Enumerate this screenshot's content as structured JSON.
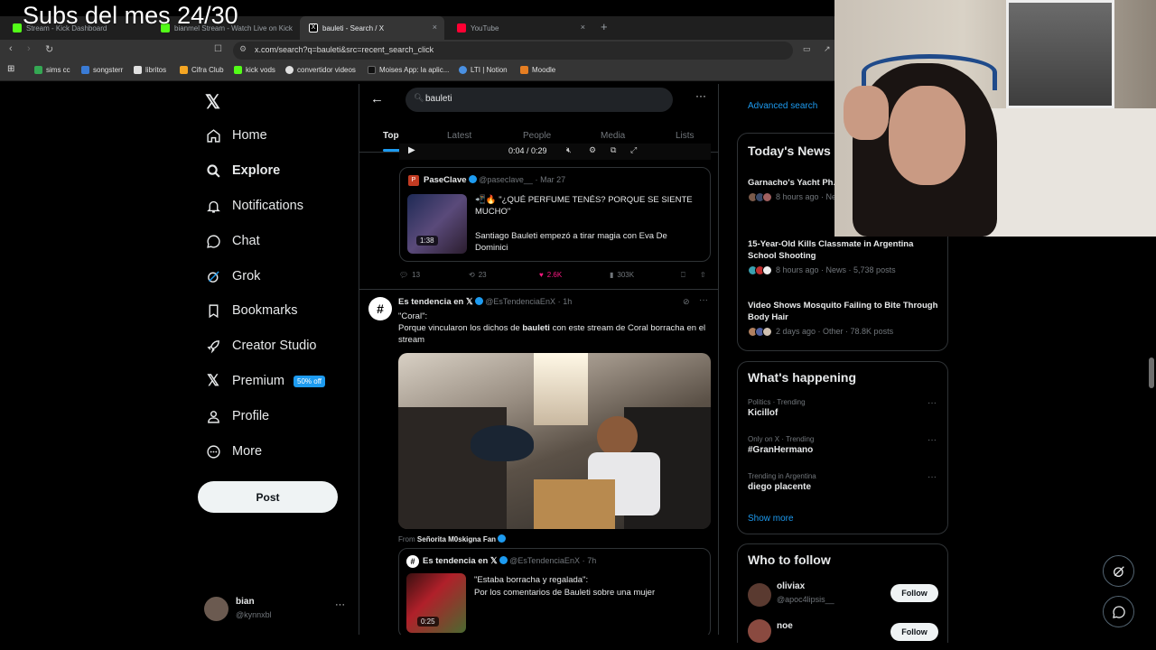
{
  "overlay": {
    "title": "Subs del mes 24/30"
  },
  "browser": {
    "tabs": [
      {
        "label": "Stream - Kick Dashboard",
        "color": "#53fc18"
      },
      {
        "label": "bianmel Stream - Watch Live on Kick",
        "color": "#53fc18"
      },
      {
        "label": "bauleti - Search / X",
        "color": "#ffffff"
      },
      {
        "label": "YouTube",
        "color": "#ff0033"
      }
    ],
    "new_tab": "+",
    "close": "×",
    "url": "x.com/search?q=bauleti&src=recent_search_click",
    "bookmarks": [
      {
        "label": "sims cc",
        "color": "#34a853"
      },
      {
        "label": "songsterr",
        "color": "#3a7bd5"
      },
      {
        "label": "libritos",
        "color": "#e0e0e0"
      },
      {
        "label": "Cifra Club",
        "color": "#f5a623"
      },
      {
        "label": "kick vods",
        "color": "#53fc18"
      },
      {
        "label": "convertidor videos",
        "color": "#e0e0e0"
      },
      {
        "label": "Moises App: la aplic...",
        "color": "#111111"
      },
      {
        "label": "LTI | Notion",
        "color": "#4a90e2"
      },
      {
        "label": "Moodle",
        "color": "#e67e22"
      }
    ]
  },
  "nav": {
    "items": [
      {
        "label": "Home",
        "icon": "home-icon"
      },
      {
        "label": "Explore",
        "icon": "search-icon"
      },
      {
        "label": "Notifications",
        "icon": "bell-icon"
      },
      {
        "label": "Chat",
        "icon": "chat-icon"
      },
      {
        "label": "Grok",
        "icon": "grok-icon"
      },
      {
        "label": "Bookmarks",
        "icon": "bookmark-icon"
      },
      {
        "label": "Creator Studio",
        "icon": "rocket-icon"
      },
      {
        "label": "Premium",
        "icon": "x-logo-icon"
      },
      {
        "label": "Profile",
        "icon": "person-icon"
      },
      {
        "label": "More",
        "icon": "more-icon"
      }
    ],
    "premium_badge": "50% off",
    "post_label": "Post",
    "user": {
      "name": "bian",
      "handle": "@kynnxbl"
    }
  },
  "search": {
    "query": "bauleti",
    "tabs": [
      "Top",
      "Latest",
      "People",
      "Media",
      "Lists"
    ],
    "active_tab": "Top"
  },
  "video_bar": {
    "time": "0:04 / 0:29"
  },
  "quoted1": {
    "name": "PaseClave",
    "handle": "@paseclave__",
    "date": "Mar 27",
    "text1": "📲🔥 \"¿QUÉ PERFUME TENÉS? PORQUE SE SIENTE MUCHO\"",
    "text2": "Santiago Bauleti empezó a tirar magia con Eva De Dominici",
    "thumb_time": "1:38"
  },
  "actions1": {
    "replies": "13",
    "reposts": "23",
    "likes": "2.6K",
    "views": "303K"
  },
  "tweet2": {
    "name": "Es tendencia en 𝕏",
    "handle": "@EsTendenciaEnX",
    "time": "1h",
    "quote_title": "\"Coral\":",
    "text_before": "Porque vincularon los dichos de ",
    "text_bold": "bauleti",
    "text_after": " con este stream de Coral borracha en el stream",
    "from_label": "From",
    "from_name": "Señorita M0skigna Fan"
  },
  "quoted2": {
    "name": "Es tendencia en 𝕏",
    "handle": "@EsTendenciaEnX",
    "time": "7h",
    "title": "\"Estaba borracha y regalada\":",
    "text": "Por los comentarios de Bauleti sobre una mujer",
    "thumb_time": "0:25"
  },
  "right": {
    "advanced_search": "Advanced search",
    "news_title": "Today's News",
    "news": [
      {
        "title": "Garnacho's Yacht Ph... Jokes on Social Med...",
        "meta": "8 hours ago · News · ..."
      },
      {
        "title": "15-Year-Old Kills Classmate in Argentina School Shooting",
        "meta": "8 hours ago · News · 5,738 posts"
      },
      {
        "title": "Video Shows Mosquito Failing to Bite Through Body Hair",
        "meta": "2 days ago · Other · 78.8K posts"
      }
    ],
    "happening_title": "What's happening",
    "trends": [
      {
        "category": "Politics · Trending",
        "name": "Kicillof"
      },
      {
        "category": "Only on X · Trending",
        "name": "#GranHermano"
      },
      {
        "category": "Trending in Argentina",
        "name": "diego placente"
      }
    ],
    "show_more": "Show more",
    "who_title": "Who to follow",
    "who": [
      {
        "name": "oliviax",
        "handle": "@apoc4lipsis__",
        "button": "Follow"
      },
      {
        "name": "noe",
        "handle": "@...",
        "button": "Follow"
      }
    ]
  },
  "colors": {
    "accent": "#1d9bf0",
    "like": "#f91880",
    "background": "#000000"
  }
}
